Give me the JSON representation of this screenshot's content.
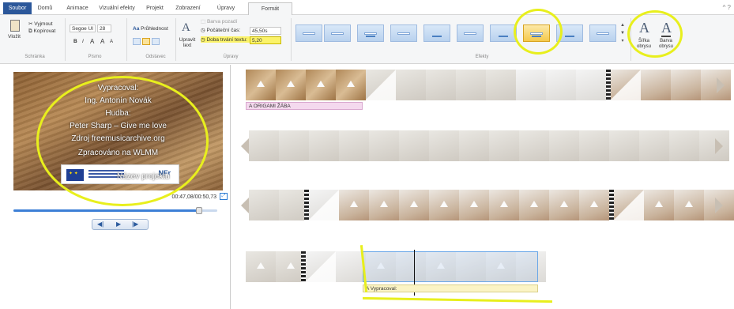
{
  "tabs": {
    "file": "Soubor",
    "home": "Domů",
    "animations": "Animace",
    "visual_effects": "Vizuální efekty",
    "project": "Projekt",
    "view": "Zobrazení",
    "edit": "Úpravy",
    "format": "Formát"
  },
  "clipboard": {
    "paste": "Vložit",
    "cut": "Vyjmout",
    "copy": "Kopírovat",
    "group": "Schránka"
  },
  "font": {
    "family": "Segoe UI",
    "size": "28",
    "bold": "B",
    "italic": "I",
    "grow": "A",
    "shrink": "A",
    "group": "Písmo"
  },
  "paragraph": {
    "transparency": "Průhlednost",
    "group": "Odstavec"
  },
  "adjust": {
    "edit_text": "Upravit text",
    "bg_color": "Barva pozadí",
    "start_time_label": "Počáteční čas:",
    "start_time_value": "45,50s",
    "duration_label": "Doba trvání textu:",
    "duration_value": "5,20",
    "group": "Úpravy"
  },
  "effects": {
    "group": "Efekty",
    "selected_index": 8
  },
  "outline": {
    "width_label": "Šířka obrysu",
    "color_label": "Barva obrysu"
  },
  "preview": {
    "lines": [
      "Vypracoval:",
      "Ing. Antonín Novák",
      "Hudba:",
      "Peter Sharp – Give me love",
      "Zdroj freemusicarchive.org",
      "Zpracováno na WLMM"
    ],
    "project_name": "Název projektu",
    "logo_text": "NFr",
    "time": "00:47,08/00:50,73",
    "progress": 0.91
  },
  "storyboard": {
    "caption1": "ORIGAMI ŽÁBA",
    "caption2": "Vypracoval:"
  },
  "colors": {
    "accent": "#2b579a",
    "highlight": "#e8ef1d"
  }
}
